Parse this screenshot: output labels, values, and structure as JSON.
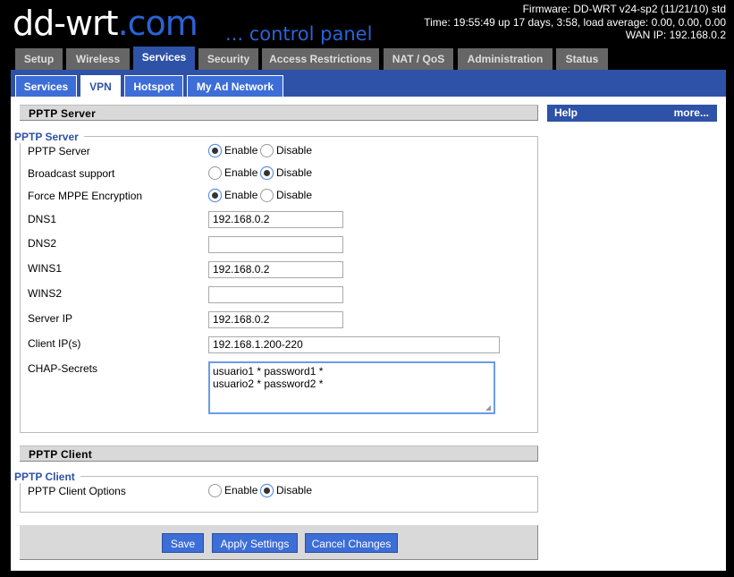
{
  "brand": {
    "logo_main": "dd-wrt",
    "logo_suffix": ".com",
    "tagline": "... control panel"
  },
  "status": {
    "firmware": "Firmware: DD-WRT v24-sp2 (11/21/10) std",
    "time": "Time: 19:55:49 up 17 days, 3:58, load average: 0.00, 0.00, 0.00",
    "wan_ip": "WAN IP: 192.168.0.2"
  },
  "main_tabs": [
    "Setup",
    "Wireless",
    "Services",
    "Security",
    "Access Restrictions",
    "NAT / QoS",
    "Administration",
    "Status"
  ],
  "main_tab_active": "Services",
  "sub_tabs": [
    "Services",
    "VPN",
    "Hotspot",
    "My Ad Network"
  ],
  "sub_tab_active": "VPN",
  "help": {
    "title": "Help",
    "more": "more..."
  },
  "pptp_server": {
    "section_title": "PPTP Server",
    "legend": "PPTP Server",
    "radio_enable": "Enable",
    "radio_disable": "Disable",
    "rows": {
      "pptp_server": {
        "label": "PPTP Server",
        "value": "Enable"
      },
      "broadcast": {
        "label": "Broadcast support",
        "value": "Disable"
      },
      "mppe": {
        "label": "Force MPPE Encryption",
        "value": "Enable"
      }
    },
    "dns1": {
      "label": "DNS1",
      "value": "192.168.0.2"
    },
    "dns2": {
      "label": "DNS2",
      "value": ""
    },
    "wins1": {
      "label": "WINS1",
      "value": "192.168.0.2"
    },
    "wins2": {
      "label": "WINS2",
      "value": ""
    },
    "server_ip": {
      "label": "Server IP",
      "value": "192.168.0.2"
    },
    "client_ips": {
      "label": "Client IP(s)",
      "value": "192.168.1.200-220"
    },
    "chap": {
      "label": "CHAP-Secrets",
      "value": "usuario1 * password1 *\nusuario2 * password2 *"
    }
  },
  "pptp_client": {
    "section_title": "PPTP Client",
    "legend": "PPTP Client",
    "options": {
      "label": "PPTP Client Options",
      "value": "Disable"
    },
    "radio_enable": "Enable",
    "radio_disable": "Disable"
  },
  "buttons": {
    "save": "Save",
    "apply": "Apply Settings",
    "cancel": "Cancel Changes"
  }
}
